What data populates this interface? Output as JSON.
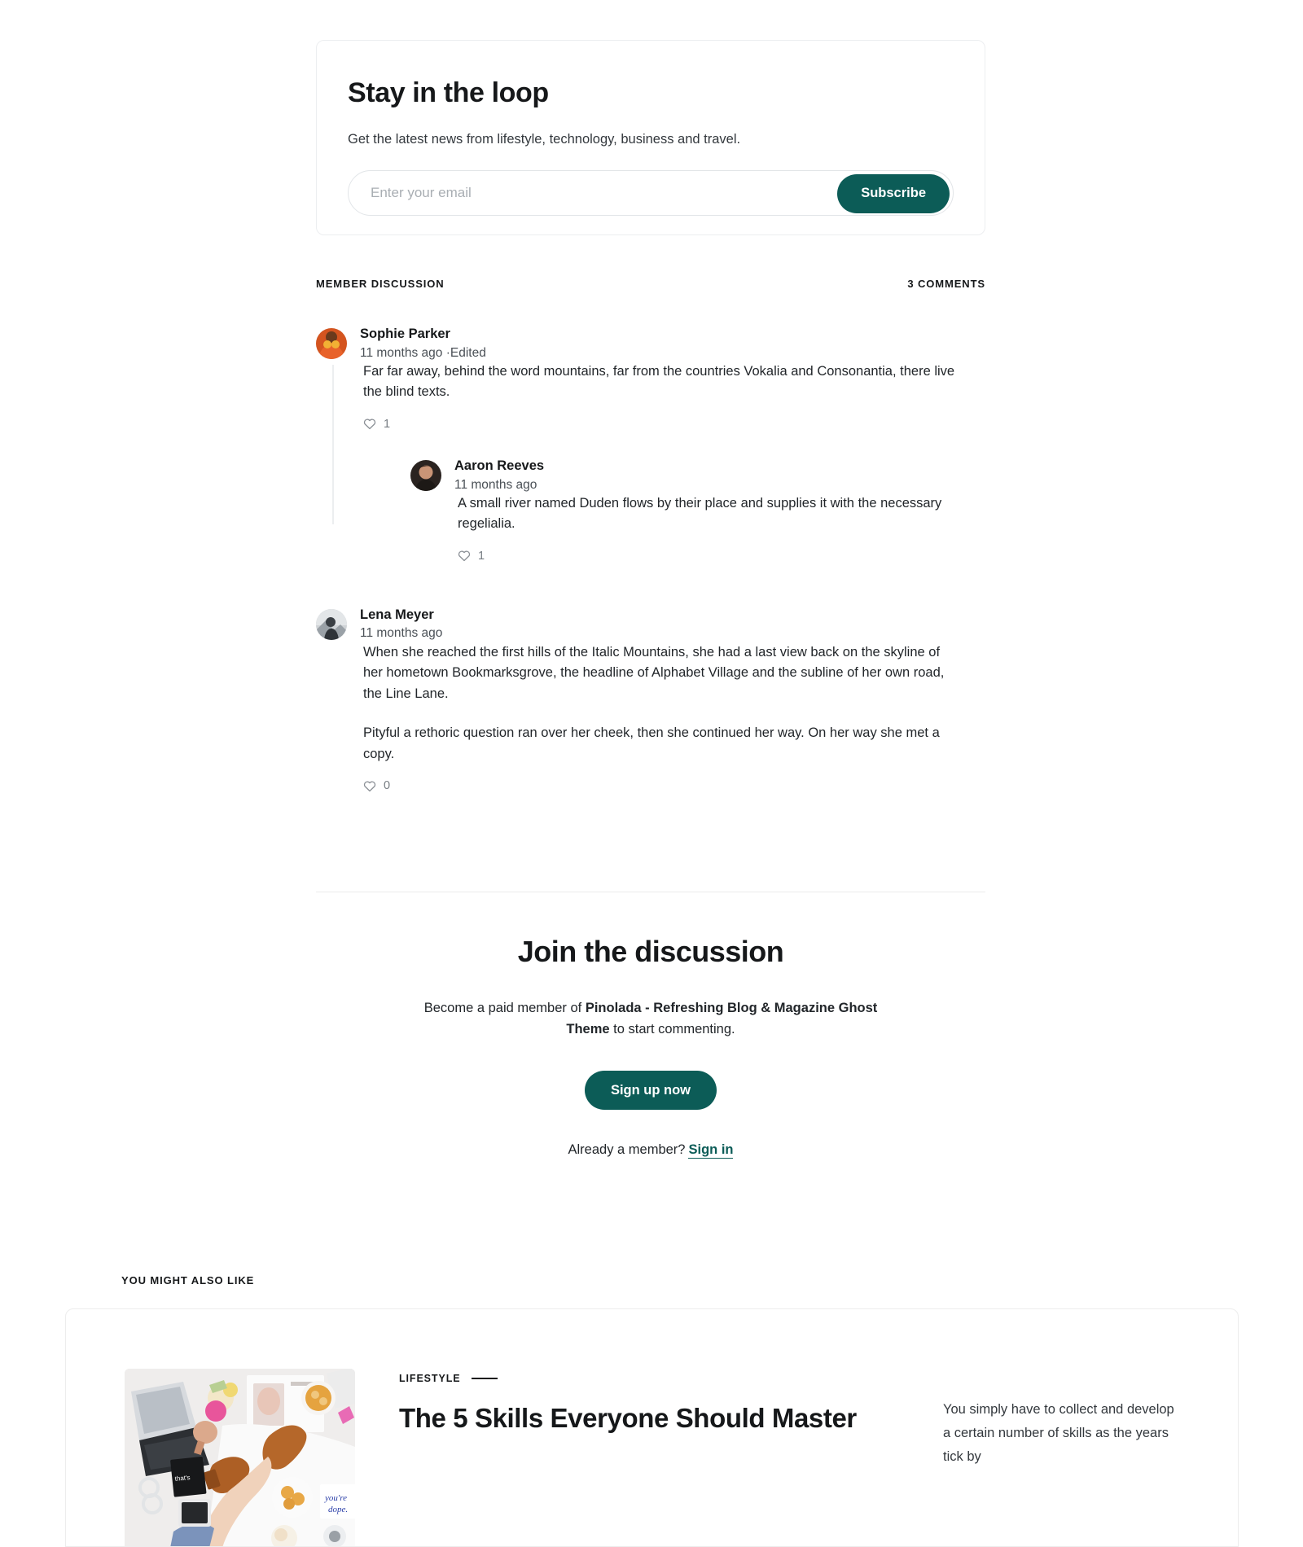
{
  "newsletter": {
    "title": "Stay in the loop",
    "subtitle": "Get the latest news from lifestyle, technology, business and travel.",
    "email_placeholder": "Enter your email",
    "email_value": "",
    "subscribe_label": "Subscribe"
  },
  "discussion": {
    "section_label": "MEMBER DISCUSSION",
    "comment_count_label": "3 COMMENTS",
    "comments": [
      {
        "author": "Sophie Parker",
        "time": "11 months ago ·Edited",
        "paragraphs": [
          "Far far away, behind the word mountains, far from the countries Vokalia and Consonantia, there live the blind texts."
        ],
        "likes": "1",
        "reply": {
          "author": "Aaron Reeves",
          "time": "11 months ago",
          "paragraphs": [
            "A small river named Duden flows by their place and supplies it with the necessary regelialia."
          ],
          "likes": "1"
        }
      },
      {
        "author": "Lena Meyer",
        "time": "11 months ago",
        "paragraphs": [
          "When she reached the first hills of the Italic Mountains, she had a last view back on the skyline of her hometown Bookmarksgrove, the headline of Alphabet Village and the subline of her own road, the Line Lane.",
          "Pityful a rethoric question ran over her cheek, then she continued her way. On her way she met a copy."
        ],
        "likes": "0"
      }
    ]
  },
  "cta": {
    "title": "Join the discussion",
    "body_prefix": "Become a paid member of ",
    "body_brand": "Pinolada - Refreshing Blog & Magazine Ghost Theme",
    "body_suffix": " to start commenting.",
    "signup_label": "Sign up now",
    "member_prompt": "Already a member?",
    "signin_label": "Sign in"
  },
  "related": {
    "section_label": "YOU MIGHT ALSO LIKE",
    "post": {
      "kicker": "LIFESTYLE",
      "title": "The 5 Skills Everyone Should Master",
      "excerpt": "You simply have to collect and develop a certain number of skills as the years tick by",
      "thumbnail_alt": "lifestyle-flatlay-photo"
    }
  },
  "colors": {
    "accent": "#0c5c57",
    "text": "#16181a",
    "muted": "#4a5056",
    "border": "#eceef0"
  }
}
